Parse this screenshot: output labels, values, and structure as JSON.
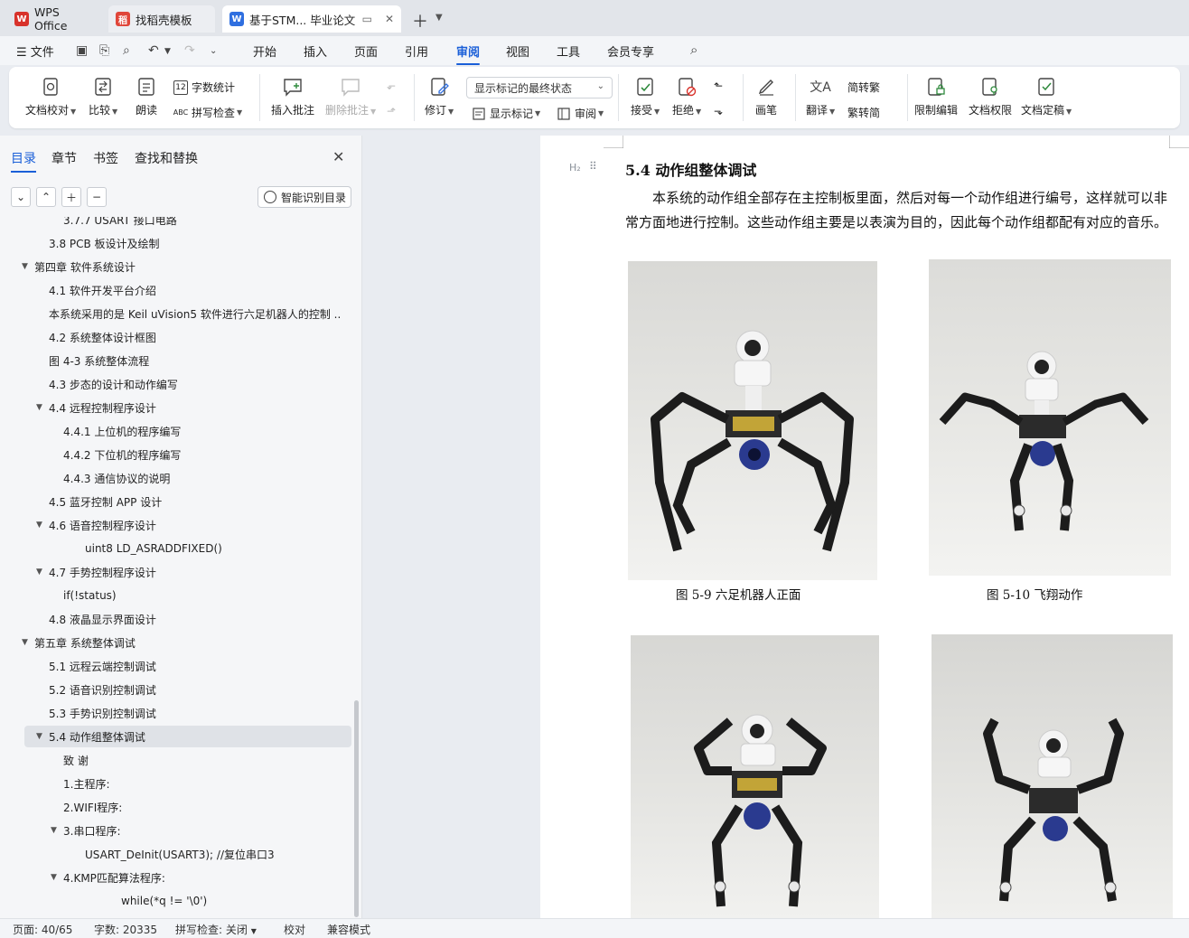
{
  "tabs": {
    "wps": "WPS Office",
    "template": "找稻壳模板",
    "doc": "基于STM... 毕业论文"
  },
  "menu": {
    "file": "文件",
    "items": [
      "开始",
      "插入",
      "页面",
      "引用",
      "审阅",
      "视图",
      "工具",
      "会员专享"
    ],
    "active": "审阅"
  },
  "ribbon": {
    "doc_check": "文档校对",
    "compare": "比较",
    "read_aloud": "朗读",
    "word_count": "字数统计",
    "spell_check": "拼写检查",
    "insert_comment": "插入批注",
    "delete_comment": "删除批注",
    "track": "修订",
    "markup_state": "显示标记的最终状态",
    "show_markup": "显示标记",
    "review_pane": "审阅",
    "accept": "接受",
    "reject": "拒绝",
    "ink": "画笔",
    "translate": "翻译",
    "to_traditional": "简转繁",
    "to_simplified": "繁转简",
    "restrict_edit": "限制编辑",
    "doc_permission": "文档权限",
    "finalize": "文档定稿"
  },
  "left_panel": {
    "tabs": [
      "目录",
      "章节",
      "书签",
      "查找和替换"
    ],
    "smart_toc": "智能识别目录",
    "toc": [
      {
        "text": "3.7.7 USART 接口电路",
        "level": 3,
        "arrow": ""
      },
      {
        "text": "3.8 PCB 板设计及绘制",
        "level": 2,
        "arrow": ""
      },
      {
        "text": "第四章  软件系统设计",
        "level": 1,
        "arrow": "▼"
      },
      {
        "text": "4.1  软件开发平台介绍",
        "level": 2,
        "arrow": ""
      },
      {
        "text": "本系统采用的是 Keil uVision5 软件进行六足机器人的控制 ...",
        "level": 2,
        "arrow": ""
      },
      {
        "text": "4.2  系统整体设计框图",
        "level": 2,
        "arrow": ""
      },
      {
        "text": "图 4-3  系统整体流程",
        "level": 2,
        "arrow": ""
      },
      {
        "text": "4.3  步态的设计和动作编写",
        "level": 2,
        "arrow": ""
      },
      {
        "text": "4.4  远程控制程序设计",
        "level": 2,
        "arrow": "▼"
      },
      {
        "text": "4.4.1  上位机的程序编写",
        "level": 3,
        "arrow": ""
      },
      {
        "text": "4.4.2  下位机的程序编写",
        "level": 3,
        "arrow": ""
      },
      {
        "text": "4.4.3  通信协议的说明",
        "level": 3,
        "arrow": ""
      },
      {
        "text": "4.5  蓝牙控制 APP 设计",
        "level": 2,
        "arrow": ""
      },
      {
        "text": "4.6  语音控制程序设计",
        "level": 2,
        "arrow": "▼"
      },
      {
        "text": "uint8 LD_ASRADDFIXED()",
        "level": 4,
        "arrow": ""
      },
      {
        "text": "4.7  手势控制程序设计",
        "level": 2,
        "arrow": "▼"
      },
      {
        "text": "if(!status)",
        "level": 3,
        "arrow": ""
      },
      {
        "text": "4.8  液晶显示界面设计",
        "level": 2,
        "arrow": ""
      },
      {
        "text": "第五章  系统整体调试",
        "level": 1,
        "arrow": "▼"
      },
      {
        "text": "5.1  远程云端控制调试",
        "level": 2,
        "arrow": ""
      },
      {
        "text": "5.2  语音识别控制调试",
        "level": 2,
        "arrow": ""
      },
      {
        "text": "5.3  手势识别控制调试",
        "level": 2,
        "arrow": ""
      },
      {
        "text": "5.4  动作组整体调试",
        "level": 2,
        "arrow": "▼",
        "selected": true
      },
      {
        "text": "致      谢",
        "level": 3,
        "arrow": ""
      },
      {
        "text": "1.主程序:",
        "level": 3,
        "arrow": ""
      },
      {
        "text": "2.WIFI程序:",
        "level": 3,
        "arrow": ""
      },
      {
        "text": "3.串口程序:",
        "level": 3,
        "arrow": "▼"
      },
      {
        "text": "USART_DeInit(USART3);    //复位串口3",
        "level": 4,
        "arrow": ""
      },
      {
        "text": "4.KMP匹配算法程序:",
        "level": 3,
        "arrow": "▼"
      },
      {
        "text": "while(*q != '\\0')",
        "level": 5,
        "arrow": ""
      }
    ]
  },
  "document": {
    "heading_marker": "H₂",
    "heading": "5.4  动作组整体调试",
    "paragraph": "本系统的动作组全部存在主控制板里面，然后对每一个动作组进行编号，这样就可以非常方面地进行控制。这些动作组主要是以表演为目的，因此每个动作组都配有对应的音乐。",
    "captions": [
      "图 5-9  六足机器人正面",
      "图 5-10  飞翔动作"
    ]
  },
  "status": {
    "page": "页面: 40/65",
    "words": "字数: 20335",
    "spell": "拼写检查: 关闭",
    "proof": "校对",
    "compat": "兼容模式"
  },
  "colors": {
    "accent": "#1a5fd8",
    "wps_red": "#d8322b"
  }
}
